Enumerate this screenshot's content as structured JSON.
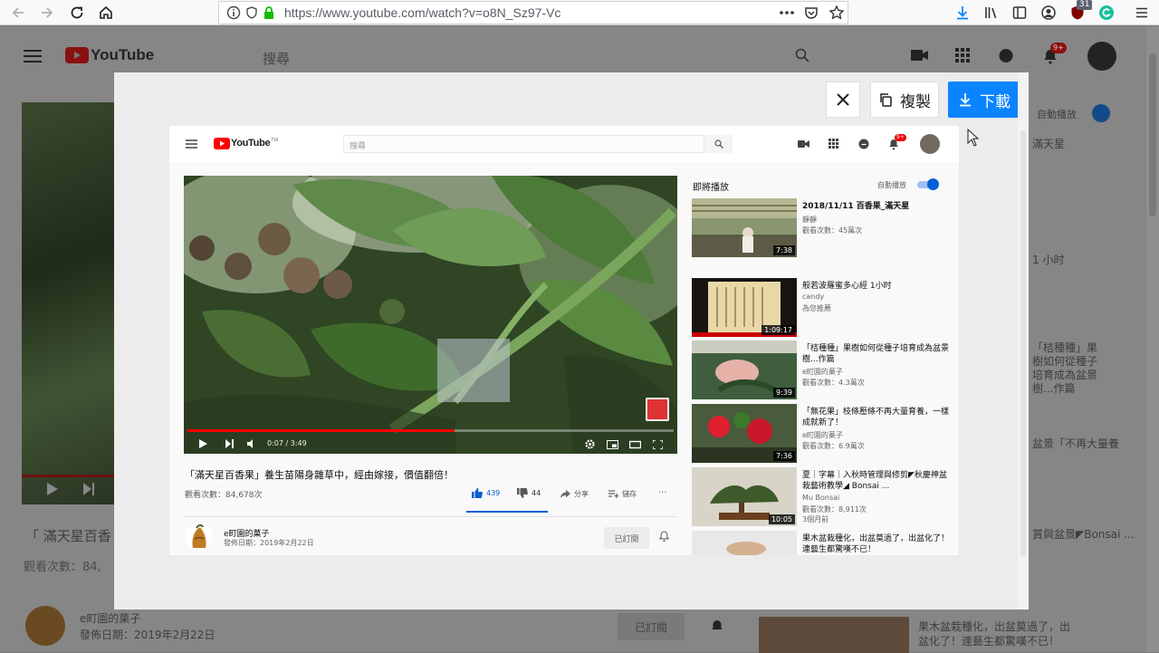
{
  "browser": {
    "url": "https://www.youtube.com/watch?v=o8N_Sz97-Vc",
    "notification_count": "31"
  },
  "background_page": {
    "search_placeholder": "搜尋",
    "logo_text": "YouTube",
    "video_title_partial": "「 滿天星百香",
    "views_partial": "觀看次數：84,",
    "channel_name": "e町園的菓子",
    "published": "發佈日期：2019年2月22日",
    "subscribe_label": "已訂閱",
    "right_autoplay": "自動播放",
    "right_title_1": "滿天星",
    "right_text_2": "1 小时",
    "right_text_3": "「桔種種」果樹如何從種子培育成為盆景樹...作篇",
    "right_text_4": "盆景「不再大量養",
    "right_text_5": "賞與盆景◤Bonsai ...",
    "bottom_right_title": "果木盆栽種化，出盆莫過了，出盆化了！連藝生都驚嘆不已！",
    "notification_badge": "9+"
  },
  "overlay": {
    "close_label": "✕",
    "copy_label": "複製",
    "download_label": "下載"
  },
  "shot": {
    "logo_text": "YouTube",
    "logo_tm": "TW",
    "search_placeholder": "搜尋",
    "notif_badge": "9+",
    "video_title": "「滿天星百香果」養生苗陽身雜草中，經由嫁接，價值翻倍！",
    "views": "觀看次數：84,678次",
    "likes": "439",
    "dislikes": "44",
    "share": "分享",
    "save": "儲存",
    "more": "...",
    "time_display": "0:07 / 3:49",
    "progress": 0.55,
    "channel_name": "e町園的菓子",
    "published": "發佈日期：2019年2月22日",
    "subscribed_label": "已訂閱",
    "upnext_label": "即將播放",
    "autoplay_label": "自動播放",
    "side_videos": [
      {
        "title": "2018/11/11 百香果_滿天星",
        "channel": "靜靜",
        "views": "觀看次數：45萬次",
        "duration": "7:38"
      },
      {
        "title": "般若波羅蜜多心經 1小时",
        "channel": "candy",
        "views": "為您推薦",
        "duration": "1:09:17"
      },
      {
        "title": "「桔種種」果樹如何從種子培育成為盆景樹...作篇",
        "channel": "e町園的菓子",
        "views": "觀看次數：4.3萬次",
        "duration": "9:39"
      },
      {
        "title": "「無花果」枝條壓條不再大量育養，一樣成就新了！",
        "channel": "e町園的菓子",
        "views": "觀看次數：6.9萬次",
        "duration": "7:36"
      },
      {
        "title": "夏｜字幕｜入秋時管理與修剪◤秋慶神盆栽藝術教學◢ Bonsai ...",
        "channel": "Mu Bonsai",
        "views": "觀看次數：8,911次",
        "extra": "3個月前",
        "duration": "10:05"
      },
      {
        "title": "果木盆栽種化，出盆莫過了，出盆化了！連藝生都驚嘆不已！",
        "channel": "",
        "views": "",
        "duration": ""
      }
    ]
  }
}
